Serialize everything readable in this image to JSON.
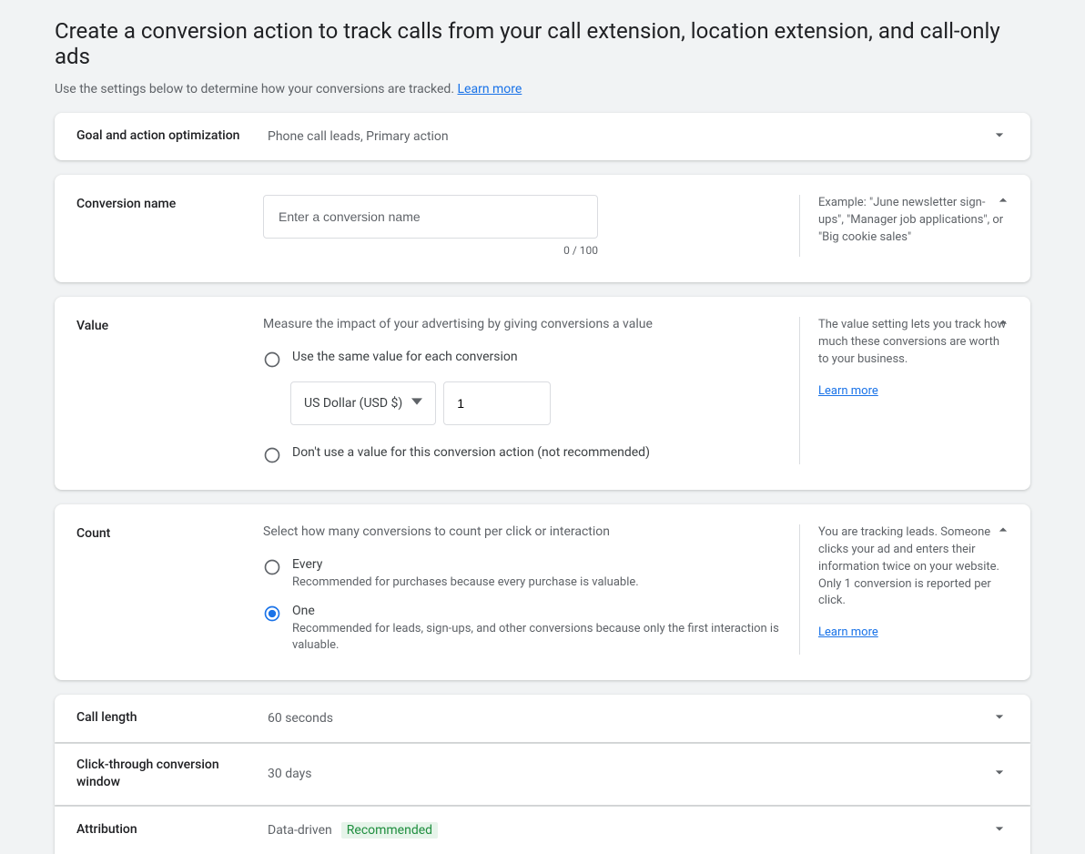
{
  "header": {
    "title": "Create a conversion action to track calls from your call extension, location extension, and call-only ads",
    "subtitle": "Use the settings below to determine how your conversions are tracked.",
    "learn_more": "Learn more"
  },
  "goal": {
    "label": "Goal and action optimization",
    "summary": "Phone call leads, Primary action"
  },
  "name": {
    "label": "Conversion name",
    "placeholder": "Enter a conversion name",
    "counter": "0 / 100",
    "help": "Example: \"June newsletter sign-ups\", \"Manager job applications\", or \"Big cookie sales\""
  },
  "value": {
    "label": "Value",
    "hint": "Measure the impact of your advertising by giving conversions a value",
    "opt_same": "Use the same value for each conversion",
    "currency": "US Dollar (USD $)",
    "amount": "1",
    "opt_none": "Don't use a value for this conversion action (not recommended)",
    "help": "The value setting lets you track how much these conversions are worth to your business.",
    "learn_more": "Learn more"
  },
  "count": {
    "label": "Count",
    "hint": "Select how many conversions to count per click or interaction",
    "opt_every": "Every",
    "opt_every_sub": "Recommended for purchases because every purchase is valuable.",
    "opt_one": "One",
    "opt_one_sub": "Recommended for leads, sign-ups, and other conversions because only the first interaction is valuable.",
    "help": "You are tracking leads. Someone clicks your ad and enters their information twice on your website. Only 1 conversion is reported per click.",
    "learn_more": "Learn more"
  },
  "call_length": {
    "label": "Call length",
    "summary": "60 seconds"
  },
  "window": {
    "label": "Click-through conversion window",
    "summary": "30 days"
  },
  "attribution": {
    "label": "Attribution",
    "summary": "Data-driven",
    "badge": "Recommended"
  }
}
